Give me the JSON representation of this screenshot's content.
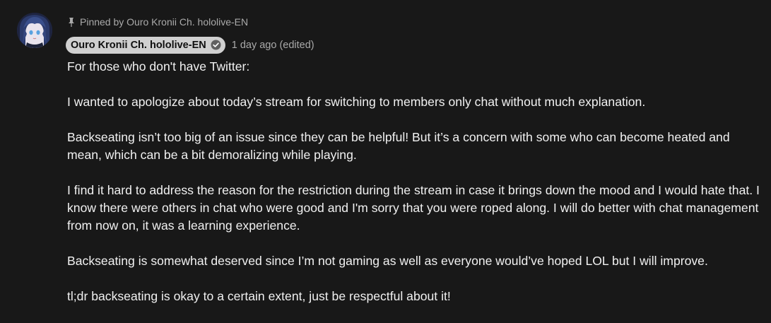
{
  "comment": {
    "pinned_text": "Pinned by Ouro Kronii Ch. hololive-EN",
    "author": "Ouro Kronii Ch. hololive-EN",
    "timestamp": "1 day ago (edited)",
    "paragraphs": [
      "For those who don't have Twitter:",
      "I wanted to apologize about today’s stream for switching to members only chat without much explanation.",
      "Backseating isn’t too big of an issue since they can be helpful! But it’s a concern with some who can become heated and mean, which can be a bit demoralizing while playing.",
      "I find it hard to address the reason for the restriction during the stream in case it brings down the mood and I would hate that. I know there were others in chat who were good and I'm sorry that you were roped along. I will do better with chat management from now on, it was a learning experience.",
      "Backseating is somewhat deserved since I’m not gaming as well as everyone would’ve hoped LOL but I will improve.",
      "tl;dr backseating is okay to a certain extent, just be respectful about it!"
    ]
  },
  "icons": {
    "pin": "pin-icon",
    "verified": "verified-check-icon",
    "avatar": "channel-avatar"
  },
  "colors": {
    "background": "#181818",
    "text": "#f1f1f1",
    "secondary_text": "#aaaaaa",
    "author_chip_bg": "#d0d0d0"
  }
}
